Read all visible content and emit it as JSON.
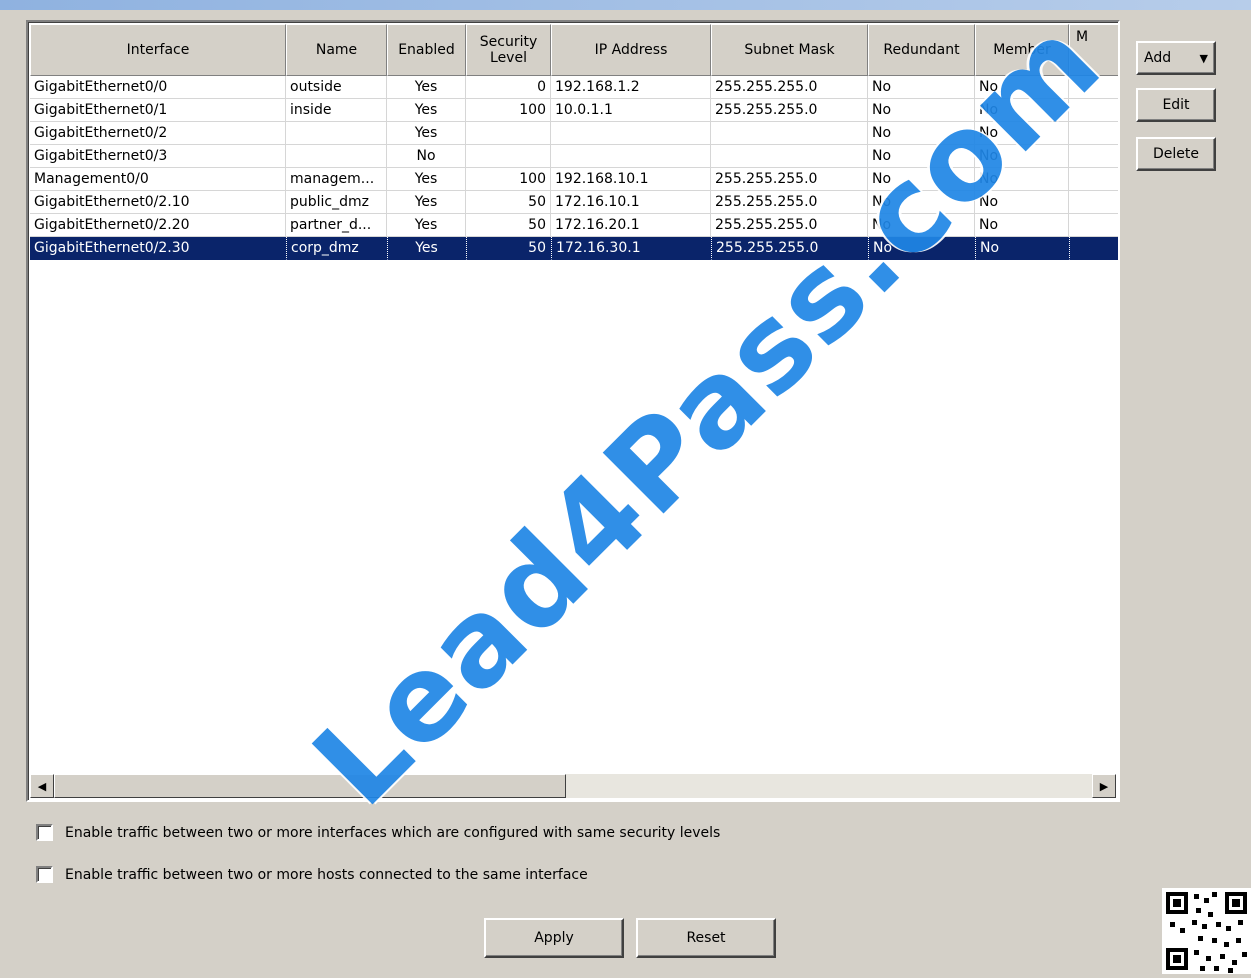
{
  "table": {
    "columns": [
      "Interface",
      "Name",
      "Enabled",
      "Security\nLevel",
      "IP Address",
      "Subnet Mask",
      "Redundant",
      "Member",
      "M"
    ],
    "rows": [
      [
        "GigabitEthernet0/0",
        "outside",
        "Yes",
        "0",
        "192.168.1.2",
        "255.255.255.0",
        "No",
        "No"
      ],
      [
        "GigabitEthernet0/1",
        "inside",
        "Yes",
        "100",
        "10.0.1.1",
        "255.255.255.0",
        "No",
        "No"
      ],
      [
        "GigabitEthernet0/2",
        "",
        "Yes",
        "",
        "",
        "",
        "No",
        "No"
      ],
      [
        "GigabitEthernet0/3",
        "",
        "No",
        "",
        "",
        "",
        "No",
        "No"
      ],
      [
        "Management0/0",
        "managem...",
        "Yes",
        "100",
        "192.168.10.1",
        "255.255.255.0",
        "No",
        "No"
      ],
      [
        "GigabitEthernet0/2.10",
        "public_dmz",
        "Yes",
        "50",
        "172.16.10.1",
        "255.255.255.0",
        "No",
        "No"
      ],
      [
        "GigabitEthernet0/2.20",
        "partner_d...",
        "Yes",
        "50",
        "172.16.20.1",
        "255.255.255.0",
        "No",
        "No"
      ],
      [
        "GigabitEthernet0/2.30",
        "corp_dmz",
        "Yes",
        "50",
        "172.16.30.1",
        "255.255.255.0",
        "No",
        "No"
      ]
    ],
    "selected_row": 7
  },
  "side_buttons": {
    "add": "Add",
    "edit": "Edit",
    "delete": "Delete"
  },
  "options": {
    "same_security": "Enable traffic between two or more interfaces which are configured with same security levels",
    "same_interface": "Enable traffic between two or more hosts connected to the same interface"
  },
  "footer": {
    "apply": "Apply",
    "reset": "Reset"
  },
  "watermark": "Lead4Pass.com"
}
